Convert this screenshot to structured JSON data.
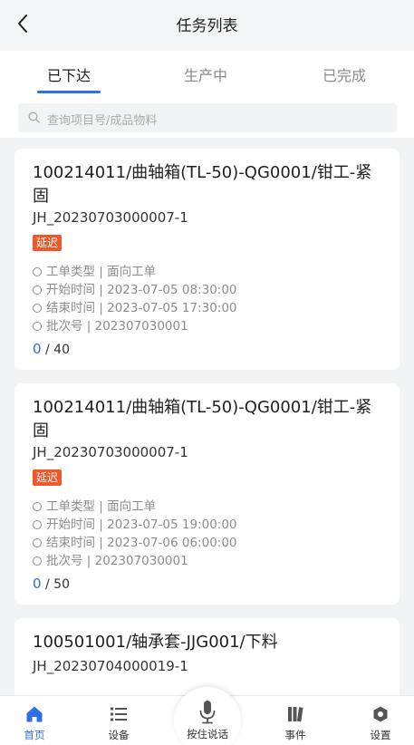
{
  "nav": {
    "title": "任务列表"
  },
  "tabs": [
    {
      "label": "已下达",
      "active": true
    },
    {
      "label": "生产中",
      "active": false
    },
    {
      "label": "已完成",
      "active": false
    }
  ],
  "search": {
    "placeholder": "查询项目号/成品物料"
  },
  "tasks": [
    {
      "title": "100214011/曲轴箱(TL-50)-QG0001/钳工-紧固",
      "code": "JH_20230703000007-1",
      "badge": "延迟",
      "info": [
        "工单类型 | 面向工单",
        "开始时间 | 2023-07-05 08:30:00",
        "结束时间 | 2023-07-05 17:30:00",
        "批次号 | 202307030001"
      ],
      "progress_done": "0",
      "progress_total": "/ 40"
    },
    {
      "title": "100214011/曲轴箱(TL-50)-QG0001/钳工-紧固",
      "code": "JH_20230703000007-1",
      "badge": "延迟",
      "info": [
        "工单类型 | 面向工单",
        "开始时间 | 2023-07-05 19:00:00",
        "结束时间 | 2023-07-06 06:00:00",
        "批次号 | 202307030001"
      ],
      "progress_done": "0",
      "progress_total": "/ 50"
    },
    {
      "title": "100501001/轴承套-JJG001/下料",
      "code": "JH_20230704000019-1"
    }
  ],
  "tabbar": {
    "items": [
      {
        "label": "首页",
        "icon": "home-icon",
        "active": true
      },
      {
        "label": "设备",
        "icon": "list-icon",
        "active": false
      },
      {
        "label": "按住说话",
        "icon": "microphone-icon",
        "active": false
      },
      {
        "label": "事件",
        "icon": "book-icon",
        "active": false
      },
      {
        "label": "设置",
        "icon": "gear-icon",
        "active": false
      }
    ]
  },
  "colors": {
    "accent": "#2f6fe4",
    "badge": "#f0572a",
    "background": "#f2f3f5"
  }
}
